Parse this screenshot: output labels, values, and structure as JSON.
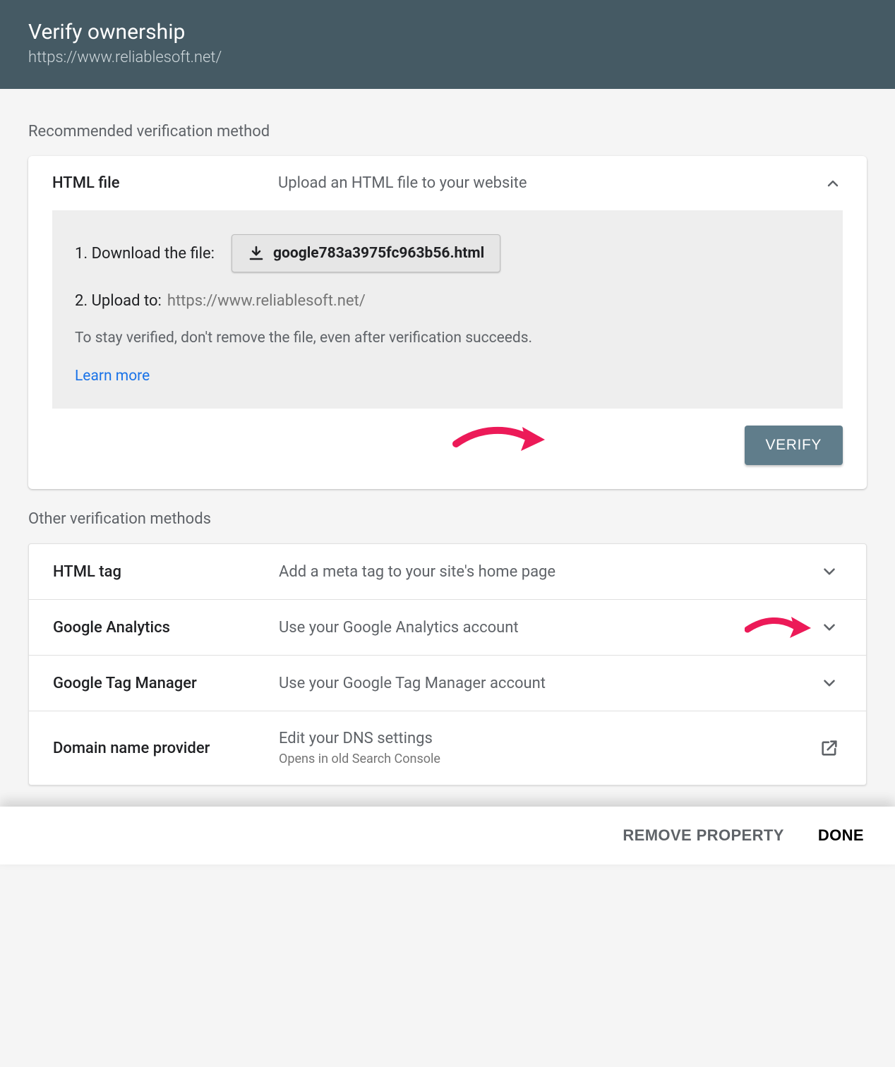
{
  "header": {
    "title": "Verify ownership",
    "url": "https://www.reliablesoft.net/"
  },
  "recommended_label": "Recommended verification method",
  "html_file": {
    "title": "HTML file",
    "desc": "Upload an HTML file to your website",
    "step1_label": "1. Download the file:",
    "download_filename": "google783a3975fc963b56.html",
    "step2_label": "2. Upload to:",
    "step2_url": "https://www.reliablesoft.net/",
    "note": "To stay verified, don't remove the file, even after verification succeeds.",
    "learn_more": "Learn more",
    "verify": "VERIFY"
  },
  "other_label": "Other verification methods",
  "other_methods": {
    "row0": {
      "title": "HTML tag",
      "desc": "Add a meta tag to your site's home page"
    },
    "row1": {
      "title": "Google Analytics",
      "desc": "Use your Google Analytics account"
    },
    "row2": {
      "title": "Google Tag Manager",
      "desc": "Use your Google Tag Manager account"
    },
    "row3": {
      "title": "Domain name provider",
      "desc": "Edit your DNS settings",
      "sub": "Opens in old Search Console"
    }
  },
  "footer": {
    "remove": "REMOVE PROPERTY",
    "done": "DONE"
  }
}
